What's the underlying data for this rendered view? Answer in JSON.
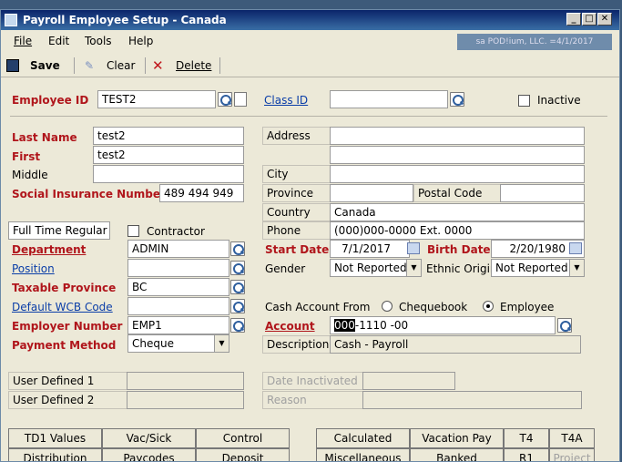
{
  "window": {
    "title": "Payroll Employee Setup - Canada",
    "company": "sa POD!ium, LLC. =4/1/2017"
  },
  "menu": {
    "file": "File",
    "edit": "Edit",
    "tools": "Tools",
    "help": "Help"
  },
  "toolbar": {
    "save": "Save",
    "clear": "Clear",
    "delete": "Delete"
  },
  "header": {
    "employee_id_label": "Employee ID",
    "employee_id": "TEST2",
    "class_id_label": "Class ID",
    "class_id": "",
    "inactive_label": "Inactive"
  },
  "left": {
    "last_name_label": "Last Name",
    "last_name": "test2",
    "first_label": "First",
    "first": "test2",
    "middle_label": "Middle",
    "middle": "",
    "sin_label": "Social Insurance Number",
    "sin": "489 494 949",
    "employment_type": "Full Time Regular",
    "contractor_label": "Contractor",
    "department_label": "Department",
    "department": "ADMIN",
    "position_label": "Position",
    "position": "",
    "taxable_province_label": "Taxable Province",
    "taxable_province": "BC",
    "default_wcb_label": "Default WCB Code",
    "default_wcb": "",
    "employer_number_label": "Employer Number",
    "employer_number": "EMP1",
    "payment_method_label": "Payment Method",
    "payment_method": "Cheque"
  },
  "right": {
    "address_label": "Address",
    "city_label": "City",
    "province_label": "Province",
    "postal_code_label": "Postal Code",
    "country_label": "Country",
    "country": "Canada",
    "phone_label": "Phone",
    "phone": "(000)000-0000 Ext. 0000",
    "start_date_label": "Start Date",
    "start_date": "7/1/2017",
    "birth_date_label": "Birth Date",
    "birth_date": "2/20/1980",
    "gender_label": "Gender",
    "gender": "Not Reported",
    "ethnic_label": "Ethnic Origin",
    "ethnic": "Not Reported",
    "cash_from_label": "Cash Account From",
    "chequebook_label": "Chequebook",
    "employee_label": "Employee",
    "account_label": "Account",
    "account_prefix": "000",
    "account_rest": "-1110 -00",
    "description_label": "Description",
    "description": "Cash - Payroll"
  },
  "bottom": {
    "user_defined_1": "User Defined 1",
    "user_defined_2": "User Defined 2",
    "date_inactivated": "Date Inactivated",
    "reason": "Reason"
  },
  "buttons": {
    "row1": [
      "TD1 Values",
      "Vac/Sick",
      "Control",
      "Calculated",
      "Vacation Pay",
      "T4",
      "T4A"
    ],
    "row2": [
      "Distribution",
      "Paycodes",
      "Deposit",
      "Miscellaneous",
      "Banked",
      "R1",
      "Project"
    ]
  }
}
